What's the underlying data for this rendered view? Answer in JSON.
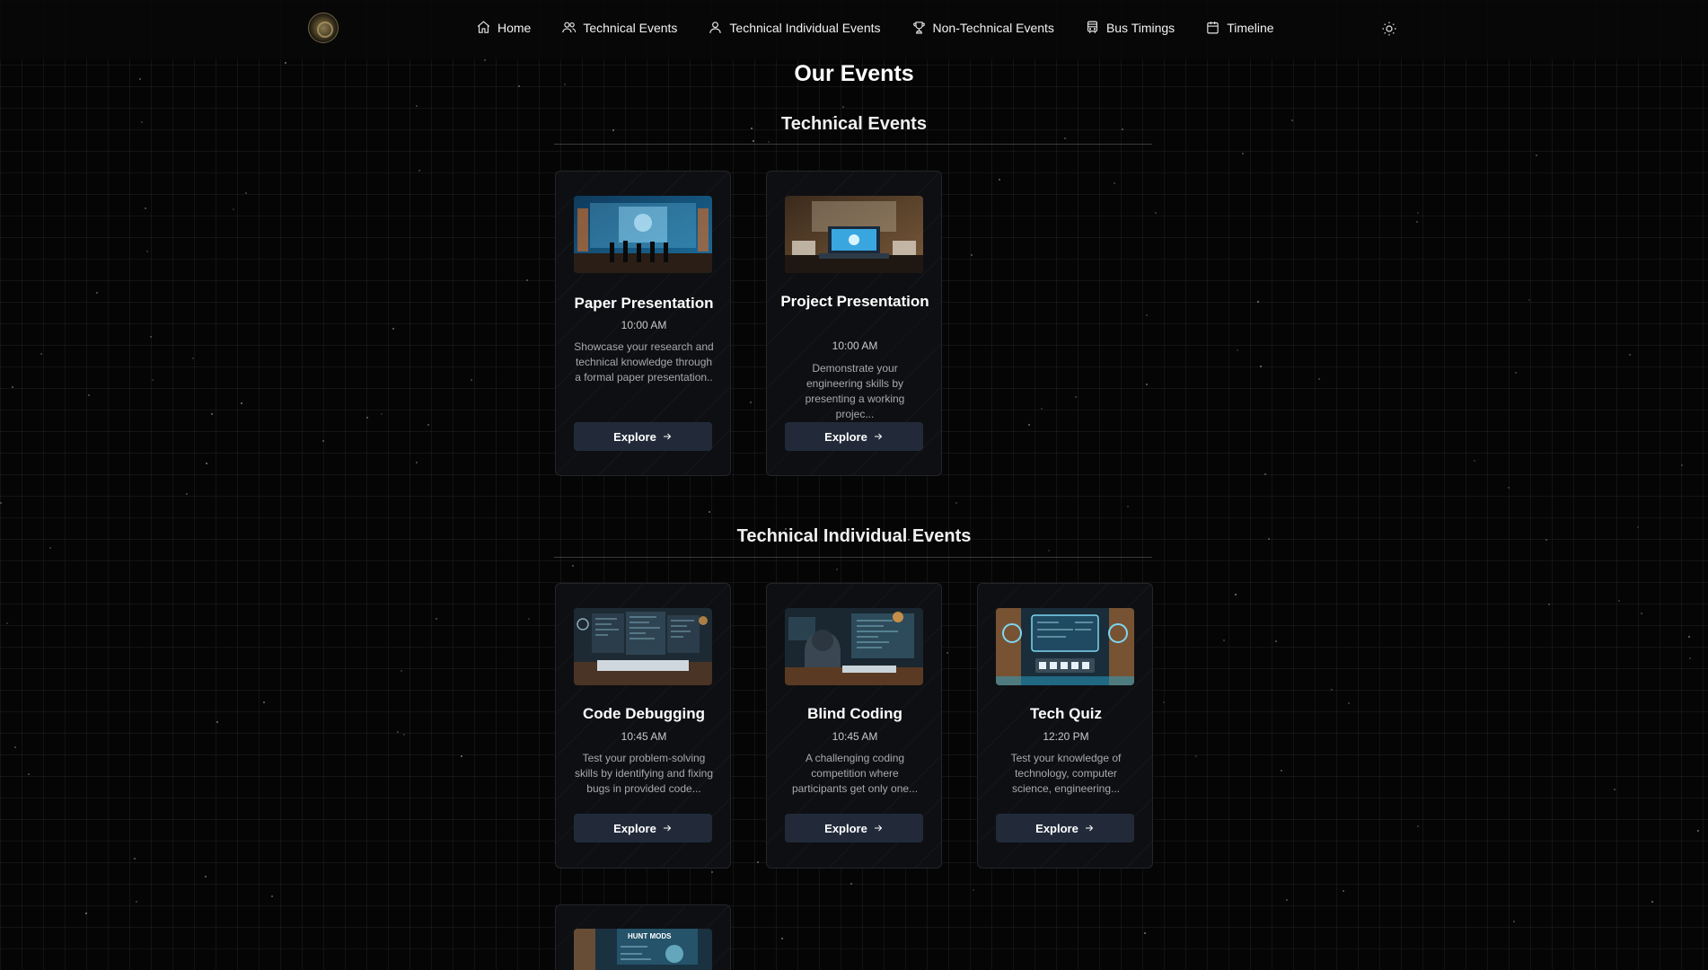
{
  "nav": {
    "items": [
      {
        "label": "Home",
        "icon": "home-icon"
      },
      {
        "label": "Technical Events",
        "icon": "users-icon"
      },
      {
        "label": "Technical Individual Events",
        "icon": "user-icon"
      },
      {
        "label": "Non-Technical Events",
        "icon": "trophy-icon"
      },
      {
        "label": "Bus Timings",
        "icon": "bus-icon"
      },
      {
        "label": "Timeline",
        "icon": "calendar-icon"
      }
    ],
    "theme_toggle_icon": "sun-icon"
  },
  "page": {
    "title": "Our Events"
  },
  "sections": [
    {
      "title": "Technical Events",
      "events": [
        {
          "title": "Paper Presentation",
          "time": "10:00 AM",
          "description": "Showcase your research and technical knowledge through a formal paper presentation..",
          "button": "Explore"
        },
        {
          "title": "Project Presentation",
          "time": "10:00 AM",
          "description": "Demonstrate your engineering skills by presenting a working projec...",
          "button": "Explore"
        }
      ]
    },
    {
      "title": "Technical Individual Events",
      "events": [
        {
          "title": "Code Debugging",
          "time": "10:45 AM",
          "description": "Test your problem-solving skills by identifying and fixing bugs in provided code...",
          "button": "Explore"
        },
        {
          "title": "Blind Coding",
          "time": "10:45 AM",
          "description": "A challenging coding competition where participants get only one...",
          "button": "Explore"
        },
        {
          "title": "Tech Quiz",
          "time": "12:20 PM",
          "description": "Test your knowledge of technology, computer science, engineering...",
          "button": "Explore"
        },
        {
          "image_caption": "HUNT MODS"
        }
      ]
    }
  ],
  "colors": {
    "background": "#050505",
    "card": "#0e0f12",
    "button": "#222a3a"
  }
}
